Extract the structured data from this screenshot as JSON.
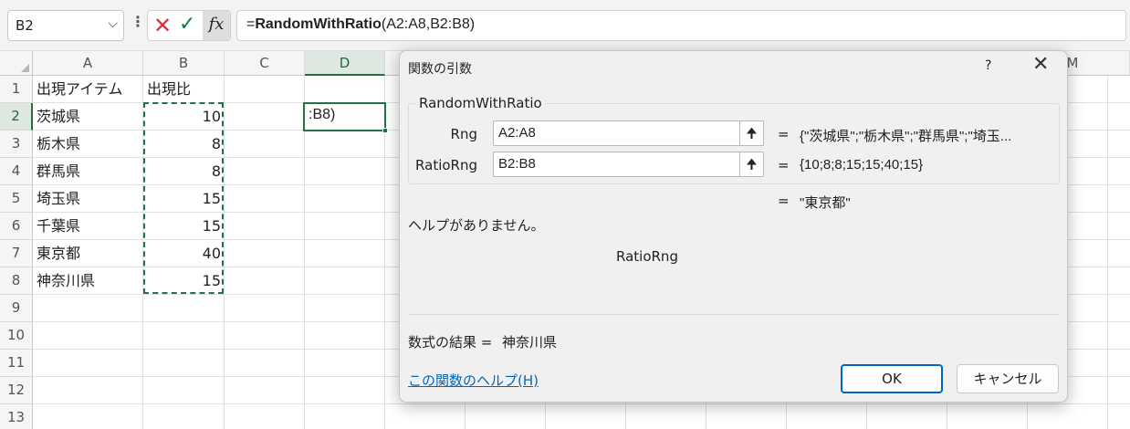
{
  "formula_bar": {
    "name_box": "B2",
    "formula_prefix": "=",
    "formula_func": "RandomWithRatio",
    "formula_args": "(A2:A8,B2:B8)",
    "fx_label": "fx"
  },
  "grid": {
    "columns": [
      "A",
      "B",
      "C",
      "D",
      "M"
    ],
    "rows": [
      "1",
      "2",
      "3",
      "4",
      "5",
      "6",
      "7",
      "8",
      "9",
      "10",
      "11",
      "12",
      "13"
    ],
    "cells": {
      "a1": "出現アイテム",
      "b1": "出現比",
      "a2": "茨城県",
      "b2": "10",
      "a3": "栃木県",
      "b3": "8",
      "a4": "群馬県",
      "b4": "8",
      "a5": "埼玉県",
      "b5": "15",
      "a6": "千葉県",
      "b6": "15",
      "a7": "東京都",
      "b7": "40",
      "a8": "神奈川県",
      "b8": "15"
    },
    "active_cell_text": ":B8)"
  },
  "dialog": {
    "title": "関数の引数",
    "help_button": "?",
    "close_button": "✕",
    "group_title": "RandomWithRatio",
    "args": [
      {
        "label": "Rng",
        "value": "A2:A8",
        "eq": "=",
        "result": "{\"茨城県\";\"栃木県\";\"群馬県\";\"埼玉..."
      },
      {
        "label": "RatioRng",
        "value": "B2:B8",
        "eq": "=",
        "result": "{10;8;8;15;15;40;15}"
      }
    ],
    "func_result_eq": "=",
    "func_result": "\"東京都\"",
    "help_text": "ヘルプがありません。",
    "arg_name": "RatioRng",
    "formula_result_label": "数式の結果 =",
    "formula_result_value": "神奈川県",
    "help_link": "この関数のヘルプ(H)",
    "ok_button": "OK",
    "cancel_button": "キャンセル"
  },
  "colors": {
    "selection_green": "#217346",
    "link_blue": "#0067c0",
    "cancel_red": "#d13438",
    "confirm_green": "#107c41"
  }
}
